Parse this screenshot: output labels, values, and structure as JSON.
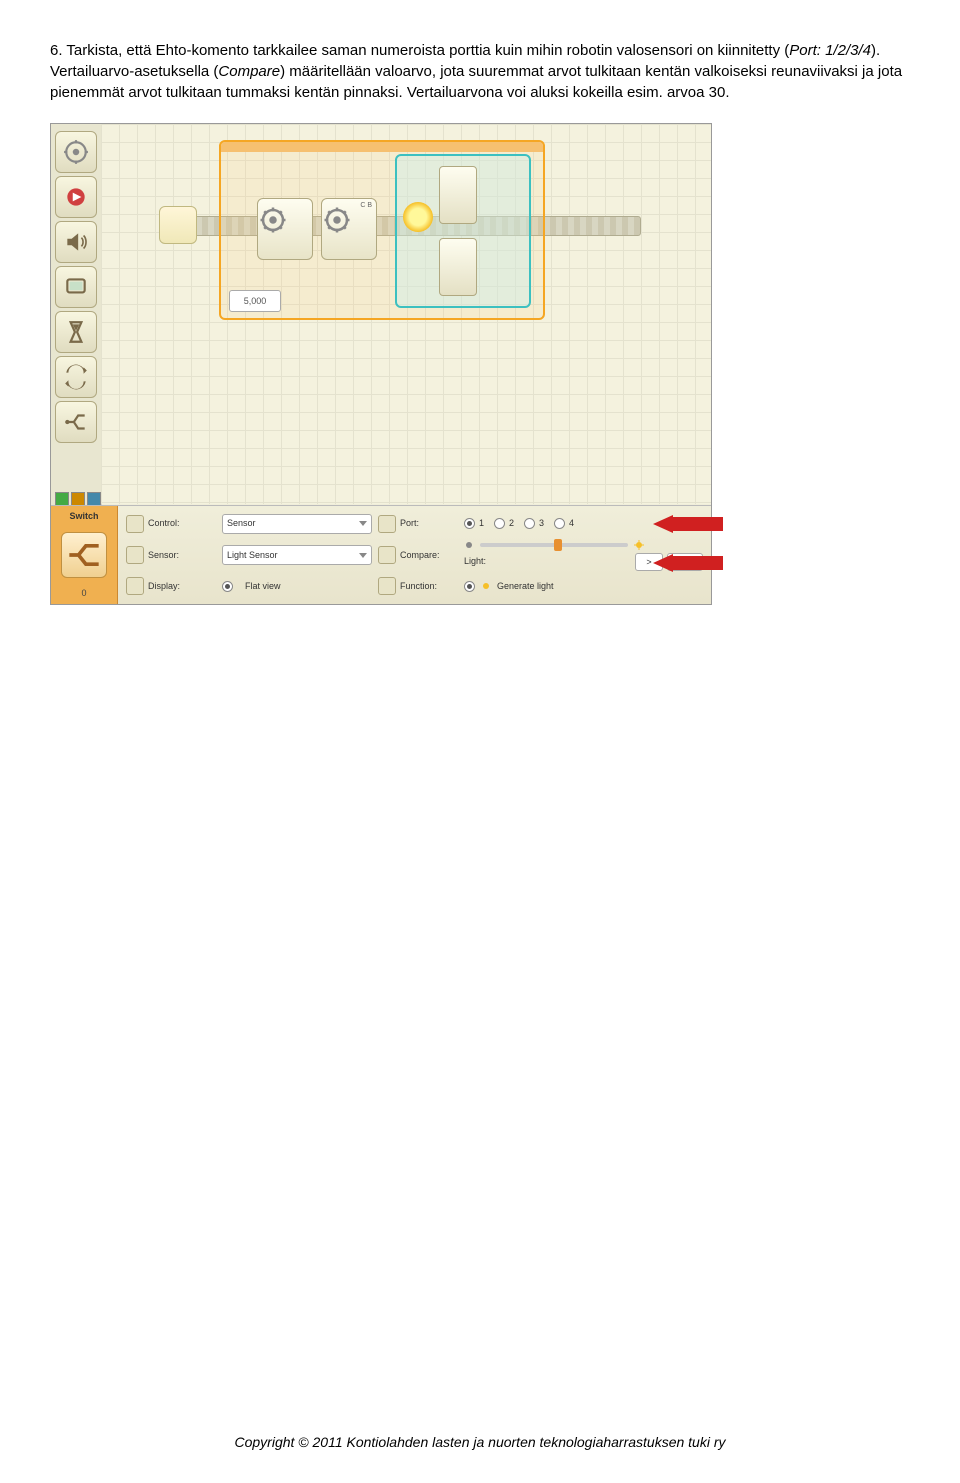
{
  "paragraph": {
    "part1": "6. Tarkista, että Ehto-komento tarkkailee saman numeroista porttia kuin mihin robotin valosensori on kiinnitetty (",
    "port_italic": "Port: 1/2/3/4",
    "part2": "). Vertailuarvo-asetuksella (",
    "compare_italic": "Compare",
    "part3": ") määritellään valoarvo, jota suuremmat arvot tulkitaan kentän valkoiseksi reunaviivaksi ja jota pienemmät arvot tulkitaan tummaksi kentän pinnaksi. Vertailuarvona voi aluksi kokeilla esim. arvoa 30."
  },
  "canvas": {
    "loop_counter": "5,000",
    "motor_label": "C B"
  },
  "config": {
    "panel_title": "Switch",
    "count": "0",
    "labels": {
      "control": "Control:",
      "sensor": "Sensor:",
      "display": "Display:",
      "port": "Port:",
      "compare": "Compare:",
      "light": "Light:",
      "function": "Function:",
      "flatview": "Flat view",
      "genlight": "Generate light"
    },
    "control_value": "Sensor",
    "sensor_value": "Light Sensor",
    "ports": [
      "1",
      "2",
      "3",
      "4"
    ],
    "port_selected": 0,
    "compare_op": ">",
    "compare_value": "50"
  },
  "footer": "Copyright © 2011 Kontiolahden lasten ja nuorten teknologiaharrastuksen tuki ry"
}
